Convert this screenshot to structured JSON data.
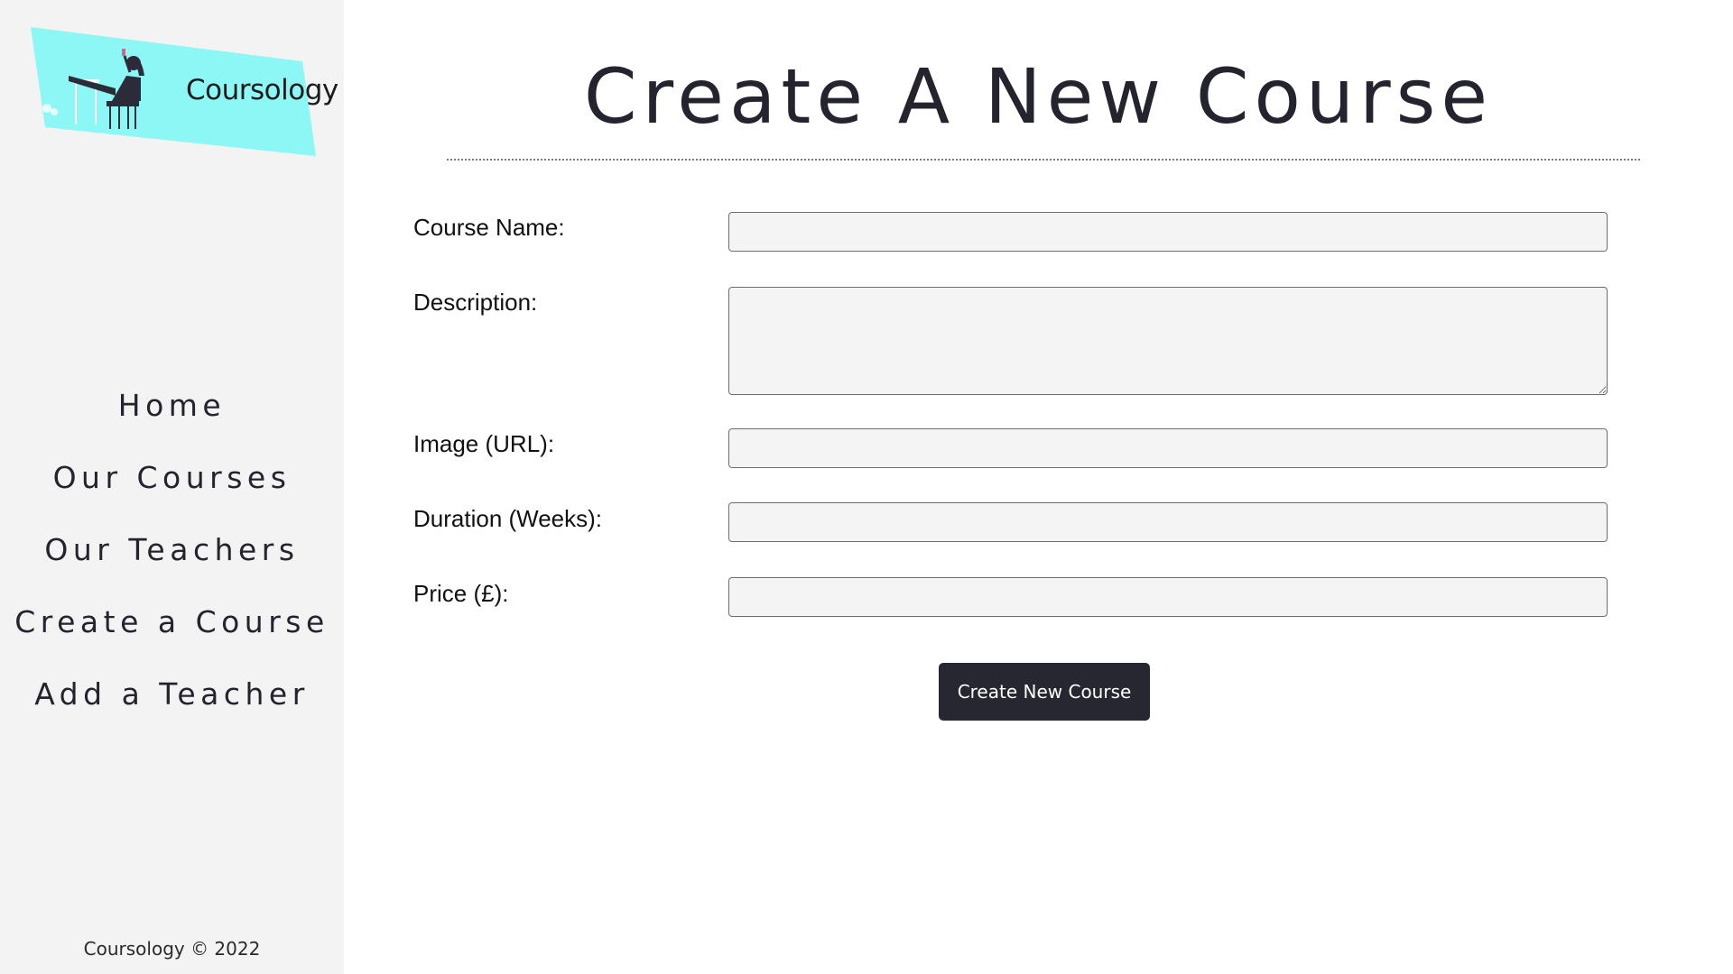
{
  "brand": {
    "name": "Coursology",
    "logo_color": "#8cf7f5"
  },
  "sidebar": {
    "items": [
      {
        "label": "Home"
      },
      {
        "label": "Our Courses"
      },
      {
        "label": "Our Teachers"
      },
      {
        "label": "Create a Course"
      },
      {
        "label": "Add a Teacher"
      }
    ],
    "footer": "Coursology © 2022"
  },
  "main": {
    "title": "Create A New Course",
    "form": {
      "course_name": {
        "label": "Course Name:",
        "value": ""
      },
      "description": {
        "label": "Description:",
        "value": ""
      },
      "image_url": {
        "label": "Image (URL):",
        "value": ""
      },
      "duration": {
        "label": "Duration (Weeks):",
        "value": ""
      },
      "price": {
        "label": "Price (£):",
        "value": ""
      }
    },
    "submit_label": "Create New Course"
  },
  "colors": {
    "sidebar_bg": "#f3f3f3",
    "text_dark": "#23242e",
    "button_bg": "#262730"
  }
}
